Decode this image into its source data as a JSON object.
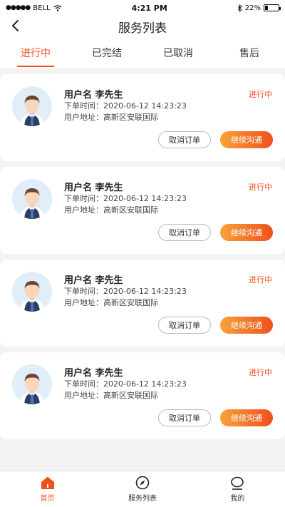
{
  "status_bar": {
    "carrier": "BELL",
    "time": "4:21 PM",
    "battery": "22%",
    "battery_level": 0.22
  },
  "header": {
    "title": "服务列表",
    "back_icon": "chevron-left-icon"
  },
  "tabs": [
    {
      "label": "进行中",
      "active": true
    },
    {
      "label": "已完结",
      "active": false
    },
    {
      "label": "已取消",
      "active": false
    },
    {
      "label": "售后",
      "active": false
    }
  ],
  "orders": [
    {
      "name": "用户名 李先生",
      "time": "下单时间：2020-06-12 14:23:23",
      "address": "用户地址：高新区安联国际",
      "status": "进行中",
      "cancel_label": "取消订单",
      "continue_label": "继续沟通"
    },
    {
      "name": "用户名 李先生",
      "time": "下单时间：2020-06-12 14:23:23",
      "address": "用户地址：高新区安联国际",
      "status": "进行中",
      "cancel_label": "取消订单",
      "continue_label": "继续沟通"
    },
    {
      "name": "用户名 李先生",
      "time": "下单时间：2020-06-12 14:23:23",
      "address": "用户地址：高新区安联国际",
      "status": "进行中",
      "cancel_label": "取消订单",
      "continue_label": "继续沟通"
    },
    {
      "name": "用户名 李先生",
      "time": "下单时间：2020-06-12 14:23:23",
      "address": "用户地址：高新区安联国际",
      "status": "进行中",
      "cancel_label": "取消订单",
      "continue_label": "继续沟通"
    }
  ],
  "tabbar": [
    {
      "label": "首页",
      "icon": "home-icon",
      "active": true
    },
    {
      "label": "服务列表",
      "icon": "compass-icon",
      "active": false
    },
    {
      "label": "我的",
      "icon": "user-icon",
      "active": false
    }
  ],
  "colors": {
    "accent": "#f0501e",
    "accent_gradient_start": "#f7a23b",
    "background": "#f3f3f3"
  }
}
